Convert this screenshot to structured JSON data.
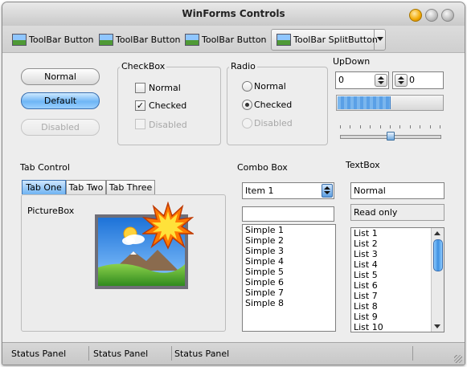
{
  "window": {
    "title": "WinForms Controls"
  },
  "toolbar": {
    "button1": "ToolBar Button",
    "button2": "ToolBar Button",
    "button3": "ToolBar Button",
    "split": "ToolBar SplitButton"
  },
  "buttons": {
    "normal": "Normal",
    "default": "Default",
    "disabled": "Disabled"
  },
  "checkbox": {
    "title": "CheckBox",
    "items": [
      {
        "label": "Normal",
        "checked": false,
        "enabled": true
      },
      {
        "label": "Checked",
        "checked": true,
        "enabled": true
      },
      {
        "label": "Disabled",
        "checked": false,
        "enabled": false
      }
    ]
  },
  "radio": {
    "title": "Radio",
    "items": [
      {
        "label": "Normal",
        "selected": false,
        "enabled": true
      },
      {
        "label": "Checked",
        "selected": true,
        "enabled": true
      },
      {
        "label": "Disabled",
        "selected": false,
        "enabled": false
      }
    ]
  },
  "updown": {
    "title": "UpDown",
    "value1": "0",
    "value2": "0",
    "progress": 0.5,
    "slider": 0.5
  },
  "tabcontrol": {
    "title": "Tab Control",
    "tabs": [
      "Tab One",
      "Tab Two",
      "Tab Three"
    ],
    "selected": 0,
    "picture_label": "PictureBox"
  },
  "combobox": {
    "title": "Combo Box",
    "selected": "Item 1",
    "list": [
      "Simple 1",
      "Simple 2",
      "Simple 3",
      "Simple 4",
      "Simple 5",
      "Simple 6",
      "Simple 7",
      "Simple 8"
    ]
  },
  "textbox": {
    "title": "TextBox",
    "normal": "Normal",
    "readonly": "Read only",
    "list": [
      "List 1",
      "List 2",
      "List 3",
      "List 4",
      "List 5",
      "List 6",
      "List 7",
      "List 8",
      "List 9",
      "List 10"
    ]
  },
  "statusbar": {
    "panels": [
      "Status Panel",
      "Status Panel",
      "Status Panel"
    ]
  },
  "icons": {
    "toolbar": "picture-icon",
    "picturebox": "landscape-picture-icon",
    "burst": "starburst-icon"
  },
  "colors": {
    "accent": "#5aa0e6",
    "window_bg": "#ededed",
    "focus_blue": "#3b73b3"
  }
}
